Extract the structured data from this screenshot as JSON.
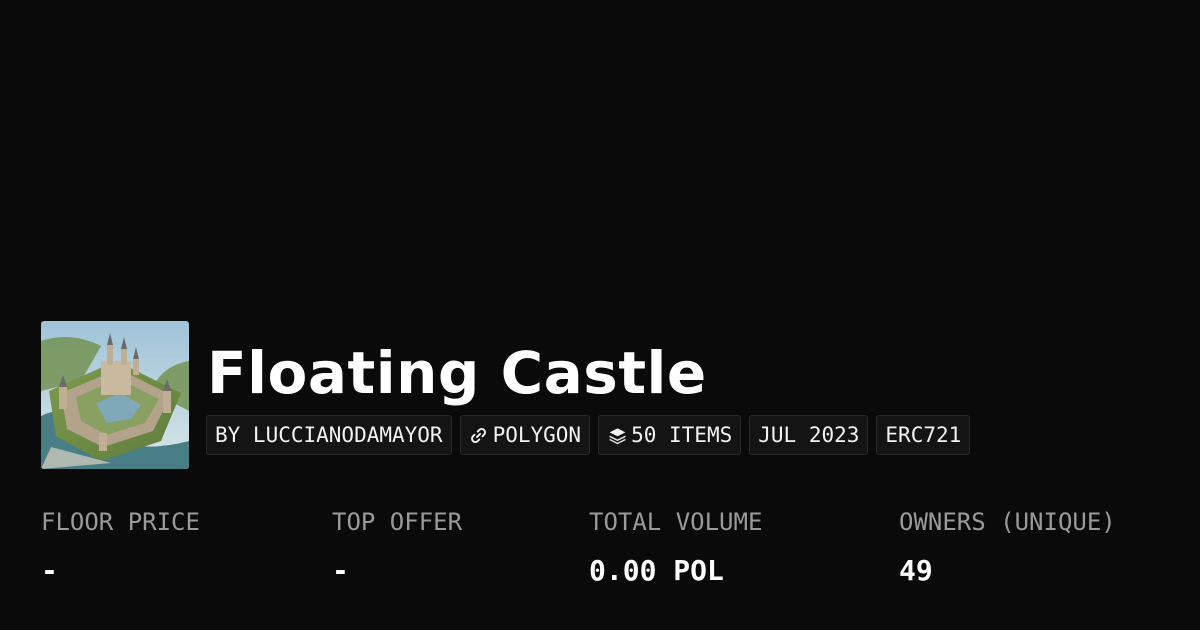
{
  "collection": {
    "name": "Floating Castle",
    "thumbnail_icon": "castle-artwork-image"
  },
  "tags": [
    {
      "label": "BY LUCCIANODAMAYOR",
      "icon": null
    },
    {
      "label": "POLYGON",
      "icon": "chain-link-icon"
    },
    {
      "label": "50 ITEMS",
      "icon": "layers-icon"
    },
    {
      "label": "JUL 2023",
      "icon": null
    },
    {
      "label": "ERC721",
      "icon": null
    }
  ],
  "stats": [
    {
      "label": "FLOOR PRICE",
      "value": "-"
    },
    {
      "label": "TOP OFFER",
      "value": "-"
    },
    {
      "label": "TOTAL VOLUME",
      "value": "0.00 POL"
    },
    {
      "label": "OWNERS (UNIQUE)",
      "value": "49"
    }
  ],
  "colors": {
    "background": "#0a0a0a",
    "text": "#ffffff",
    "muted_label": "#9a9a9a",
    "tag_background": "#141414",
    "tag_border": "#2a2a2a"
  }
}
